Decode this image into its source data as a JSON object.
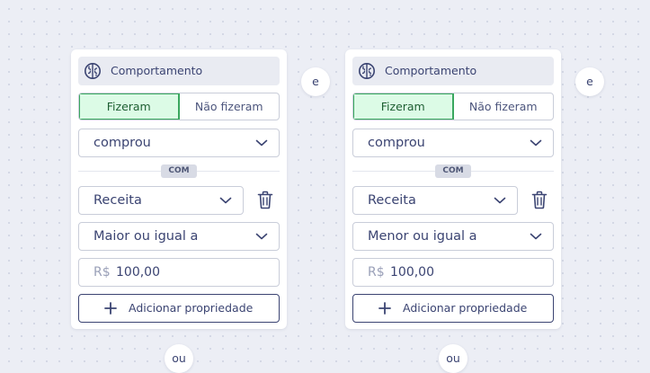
{
  "icons": {
    "category": "brain-icon",
    "chevron": "chevron-down-icon",
    "delete": "trash-icon",
    "add": "plus-icon"
  },
  "colors": {
    "primary": "#3b4472",
    "active_toggle_bg": "#dcfbe6",
    "active_toggle_border": "#39a75e"
  },
  "cards": [
    {
      "category": "Comportamento",
      "toggle": [
        "Fizeram",
        "Não fizeram"
      ],
      "toggle_active": "Fizeram",
      "event": "comprou",
      "with_label": "COM",
      "property": "Receita",
      "operator": "Maior ou igual a",
      "currency": "R$",
      "amount": "100,00",
      "add_property": "Adicionar propriedade"
    },
    {
      "category": "Comportamento",
      "toggle": [
        "Fizeram",
        "Não fizeram"
      ],
      "toggle_active": "Fizeram",
      "event": "comprou",
      "with_label": "COM",
      "property": "Receita",
      "operator": "Menor ou igual a",
      "currency": "R$",
      "amount": "100,00",
      "add_property": "Adicionar propriedade"
    }
  ],
  "connectors": {
    "and": "e",
    "or": "ou"
  }
}
